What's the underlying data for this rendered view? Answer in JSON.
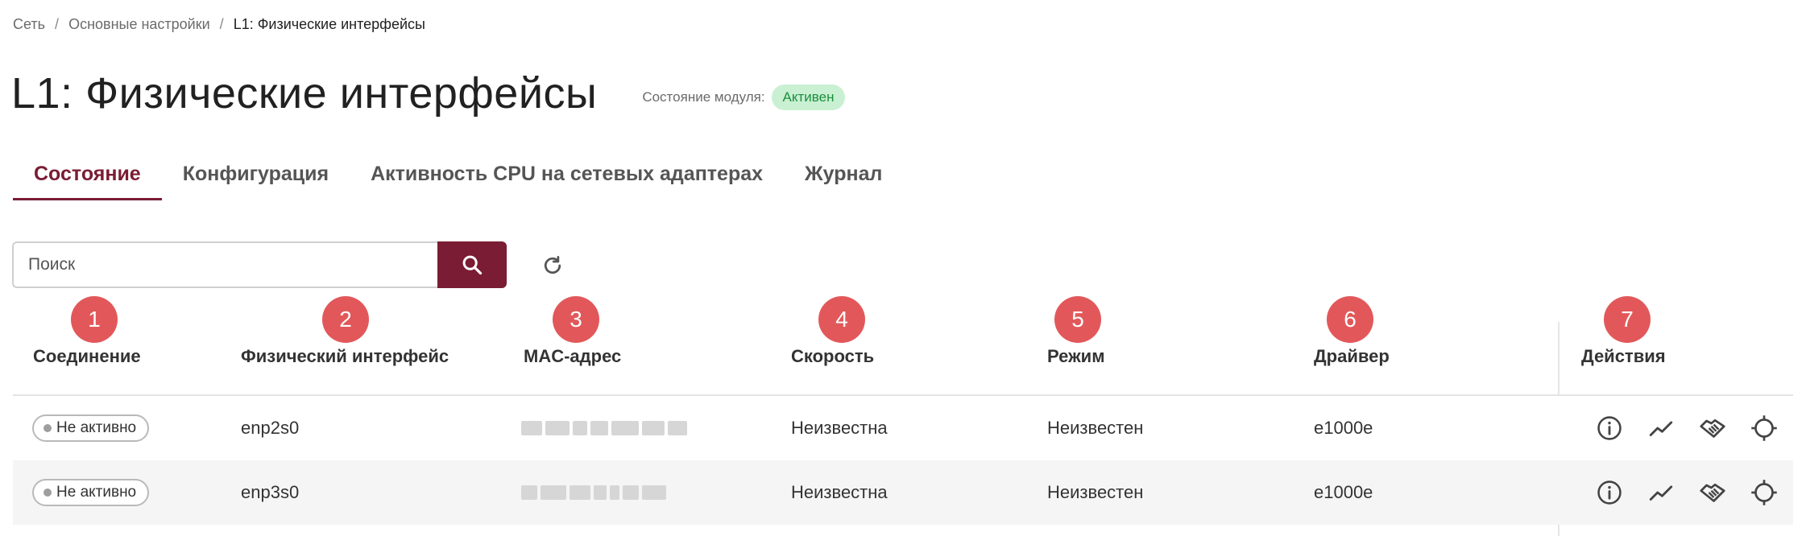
{
  "breadcrumb": {
    "items": [
      "Сеть",
      "Основные настройки"
    ],
    "current": "L1: Физические интерфейсы",
    "separator": "/"
  },
  "page": {
    "title": "L1: Физические интерфейсы",
    "module_status_label": "Состояние модуля:",
    "module_status_value": "Активен"
  },
  "tabs": [
    {
      "label": "Состояние",
      "active": true
    },
    {
      "label": "Конфигурация",
      "active": false
    },
    {
      "label": "Активность CPU на сетевых адаптерах",
      "active": false
    },
    {
      "label": "Журнал",
      "active": false
    }
  ],
  "search": {
    "placeholder": "Поиск",
    "value": ""
  },
  "markers": [
    "1",
    "2",
    "3",
    "4",
    "5",
    "6",
    "7"
  ],
  "table": {
    "columns": [
      "Соединение",
      "Физический интерфейс",
      "MAC-адрес",
      "Скорость",
      "Режим",
      "Драйвер",
      "Действия"
    ],
    "rows": [
      {
        "connection": "Не активно",
        "interface": "enp2s0",
        "speed": "Неизвестна",
        "mode": "Неизвестен",
        "driver": "e1000e"
      },
      {
        "connection": "Не активно",
        "interface": "enp3s0",
        "speed": "Неизвестна",
        "mode": "Неизвестен",
        "driver": "e1000e"
      }
    ],
    "row_actions": [
      "info-icon",
      "chart-line-icon",
      "handshake-icon",
      "crosshair-icon"
    ]
  },
  "colors": {
    "accent": "#7a1c33",
    "marker": "#e2585a",
    "status_active_bg": "#c9f0d2",
    "status_active_text": "#1c8f3e"
  }
}
